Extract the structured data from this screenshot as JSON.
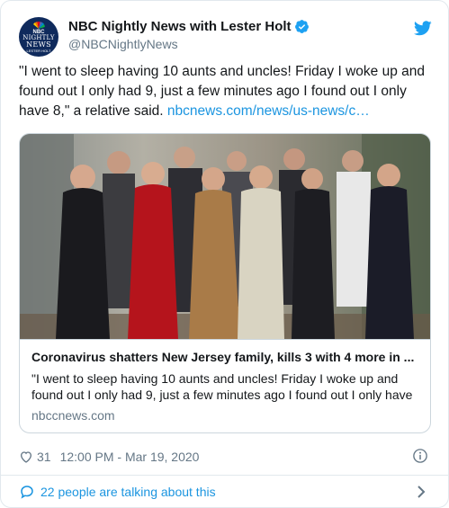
{
  "author": {
    "display_name": "NBC Nightly News with Lester Holt",
    "handle": "@NBCNightlyNews",
    "avatar_text": {
      "nbc": "NBC",
      "nightly": "NIGHTLY",
      "news": "NEWS",
      "lester": "LESTER HOLT"
    },
    "verified": true
  },
  "tweet": {
    "text": "\"I went to sleep having 10 aunts and uncles! Friday I woke up and found out I only had 9, just a few minutes ago I found out I only have 8,\" a relative said. ",
    "link_text": "nbcnews.com/news/us-news/c…"
  },
  "card": {
    "title": "Coronavirus shatters New Jersey family, kills 3 with 4 more in ...",
    "description": "\"I went to sleep having 10 aunts and uncles! Friday I woke up and found out I only had 9, just a few minutes ago I found out I only have",
    "domain": "nbccnews.com"
  },
  "meta": {
    "likes": "31",
    "timestamp": "12:00 PM - Mar 19, 2020"
  },
  "footer": {
    "talking": "22 people are talking about this"
  },
  "colors": {
    "link": "#1b95e0",
    "secondary_text": "#657786",
    "border": "#e1e8ed",
    "avatar_bg": "#0f2a5c"
  },
  "icons": [
    "nbc-peacock-icon",
    "verified-badge-icon",
    "twitter-bird-icon",
    "heart-icon",
    "info-icon",
    "speech-bubble-icon",
    "chevron-right-icon"
  ]
}
